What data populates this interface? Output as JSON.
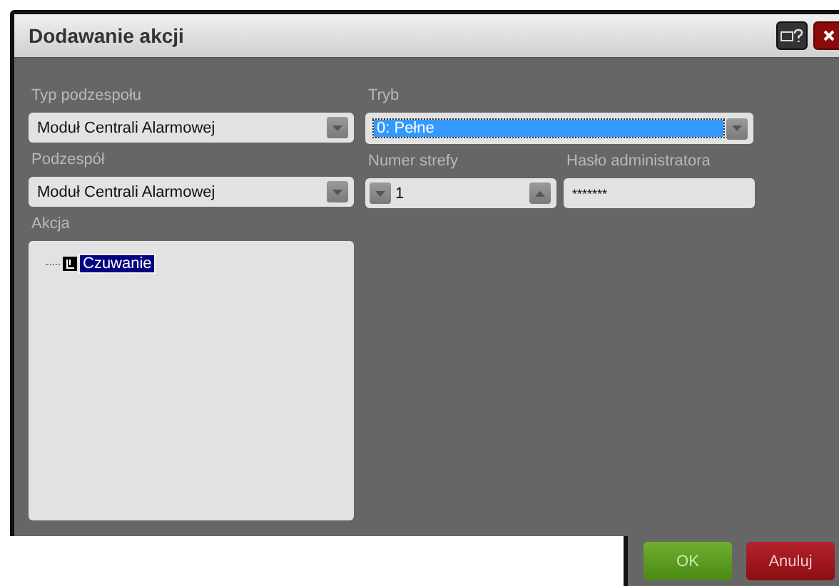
{
  "window": {
    "title": "Dodawanie akcji"
  },
  "component_type": {
    "label": "Typ podzespołu",
    "value": "Moduł Centrali Alarmowej"
  },
  "component": {
    "label": "Podzespół",
    "value": "Moduł Centrali Alarmowej"
  },
  "action": {
    "label": "Akcja",
    "items": [
      {
        "label": "Czuwanie",
        "selected": true
      }
    ]
  },
  "mode": {
    "label": "Tryb",
    "value": "0: Pełne"
  },
  "zone_number": {
    "label": "Numer strefy",
    "value": "1"
  },
  "admin_password": {
    "label": "Hasło administratora",
    "value": "*******"
  },
  "buttons": [
    {
      "label": "OK",
      "kind": "ok"
    },
    {
      "label": "Anuluj",
      "kind": "cancel"
    }
  ]
}
